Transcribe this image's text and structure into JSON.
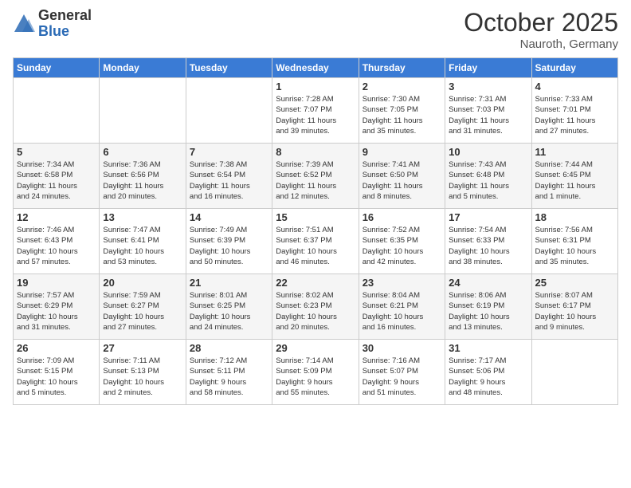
{
  "header": {
    "logo_general": "General",
    "logo_blue": "Blue",
    "month": "October 2025",
    "location": "Nauroth, Germany"
  },
  "days_of_week": [
    "Sunday",
    "Monday",
    "Tuesday",
    "Wednesday",
    "Thursday",
    "Friday",
    "Saturday"
  ],
  "weeks": [
    [
      {
        "day": "",
        "info": ""
      },
      {
        "day": "",
        "info": ""
      },
      {
        "day": "",
        "info": ""
      },
      {
        "day": "1",
        "info": "Sunrise: 7:28 AM\nSunset: 7:07 PM\nDaylight: 11 hours\nand 39 minutes."
      },
      {
        "day": "2",
        "info": "Sunrise: 7:30 AM\nSunset: 7:05 PM\nDaylight: 11 hours\nand 35 minutes."
      },
      {
        "day": "3",
        "info": "Sunrise: 7:31 AM\nSunset: 7:03 PM\nDaylight: 11 hours\nand 31 minutes."
      },
      {
        "day": "4",
        "info": "Sunrise: 7:33 AM\nSunset: 7:01 PM\nDaylight: 11 hours\nand 27 minutes."
      }
    ],
    [
      {
        "day": "5",
        "info": "Sunrise: 7:34 AM\nSunset: 6:58 PM\nDaylight: 11 hours\nand 24 minutes."
      },
      {
        "day": "6",
        "info": "Sunrise: 7:36 AM\nSunset: 6:56 PM\nDaylight: 11 hours\nand 20 minutes."
      },
      {
        "day": "7",
        "info": "Sunrise: 7:38 AM\nSunset: 6:54 PM\nDaylight: 11 hours\nand 16 minutes."
      },
      {
        "day": "8",
        "info": "Sunrise: 7:39 AM\nSunset: 6:52 PM\nDaylight: 11 hours\nand 12 minutes."
      },
      {
        "day": "9",
        "info": "Sunrise: 7:41 AM\nSunset: 6:50 PM\nDaylight: 11 hours\nand 8 minutes."
      },
      {
        "day": "10",
        "info": "Sunrise: 7:43 AM\nSunset: 6:48 PM\nDaylight: 11 hours\nand 5 minutes."
      },
      {
        "day": "11",
        "info": "Sunrise: 7:44 AM\nSunset: 6:45 PM\nDaylight: 11 hours\nand 1 minute."
      }
    ],
    [
      {
        "day": "12",
        "info": "Sunrise: 7:46 AM\nSunset: 6:43 PM\nDaylight: 10 hours\nand 57 minutes."
      },
      {
        "day": "13",
        "info": "Sunrise: 7:47 AM\nSunset: 6:41 PM\nDaylight: 10 hours\nand 53 minutes."
      },
      {
        "day": "14",
        "info": "Sunrise: 7:49 AM\nSunset: 6:39 PM\nDaylight: 10 hours\nand 50 minutes."
      },
      {
        "day": "15",
        "info": "Sunrise: 7:51 AM\nSunset: 6:37 PM\nDaylight: 10 hours\nand 46 minutes."
      },
      {
        "day": "16",
        "info": "Sunrise: 7:52 AM\nSunset: 6:35 PM\nDaylight: 10 hours\nand 42 minutes."
      },
      {
        "day": "17",
        "info": "Sunrise: 7:54 AM\nSunset: 6:33 PM\nDaylight: 10 hours\nand 38 minutes."
      },
      {
        "day": "18",
        "info": "Sunrise: 7:56 AM\nSunset: 6:31 PM\nDaylight: 10 hours\nand 35 minutes."
      }
    ],
    [
      {
        "day": "19",
        "info": "Sunrise: 7:57 AM\nSunset: 6:29 PM\nDaylight: 10 hours\nand 31 minutes."
      },
      {
        "day": "20",
        "info": "Sunrise: 7:59 AM\nSunset: 6:27 PM\nDaylight: 10 hours\nand 27 minutes."
      },
      {
        "day": "21",
        "info": "Sunrise: 8:01 AM\nSunset: 6:25 PM\nDaylight: 10 hours\nand 24 minutes."
      },
      {
        "day": "22",
        "info": "Sunrise: 8:02 AM\nSunset: 6:23 PM\nDaylight: 10 hours\nand 20 minutes."
      },
      {
        "day": "23",
        "info": "Sunrise: 8:04 AM\nSunset: 6:21 PM\nDaylight: 10 hours\nand 16 minutes."
      },
      {
        "day": "24",
        "info": "Sunrise: 8:06 AM\nSunset: 6:19 PM\nDaylight: 10 hours\nand 13 minutes."
      },
      {
        "day": "25",
        "info": "Sunrise: 8:07 AM\nSunset: 6:17 PM\nDaylight: 10 hours\nand 9 minutes."
      }
    ],
    [
      {
        "day": "26",
        "info": "Sunrise: 7:09 AM\nSunset: 5:15 PM\nDaylight: 10 hours\nand 5 minutes."
      },
      {
        "day": "27",
        "info": "Sunrise: 7:11 AM\nSunset: 5:13 PM\nDaylight: 10 hours\nand 2 minutes."
      },
      {
        "day": "28",
        "info": "Sunrise: 7:12 AM\nSunset: 5:11 PM\nDaylight: 9 hours\nand 58 minutes."
      },
      {
        "day": "29",
        "info": "Sunrise: 7:14 AM\nSunset: 5:09 PM\nDaylight: 9 hours\nand 55 minutes."
      },
      {
        "day": "30",
        "info": "Sunrise: 7:16 AM\nSunset: 5:07 PM\nDaylight: 9 hours\nand 51 minutes."
      },
      {
        "day": "31",
        "info": "Sunrise: 7:17 AM\nSunset: 5:06 PM\nDaylight: 9 hours\nand 48 minutes."
      },
      {
        "day": "",
        "info": ""
      }
    ]
  ]
}
